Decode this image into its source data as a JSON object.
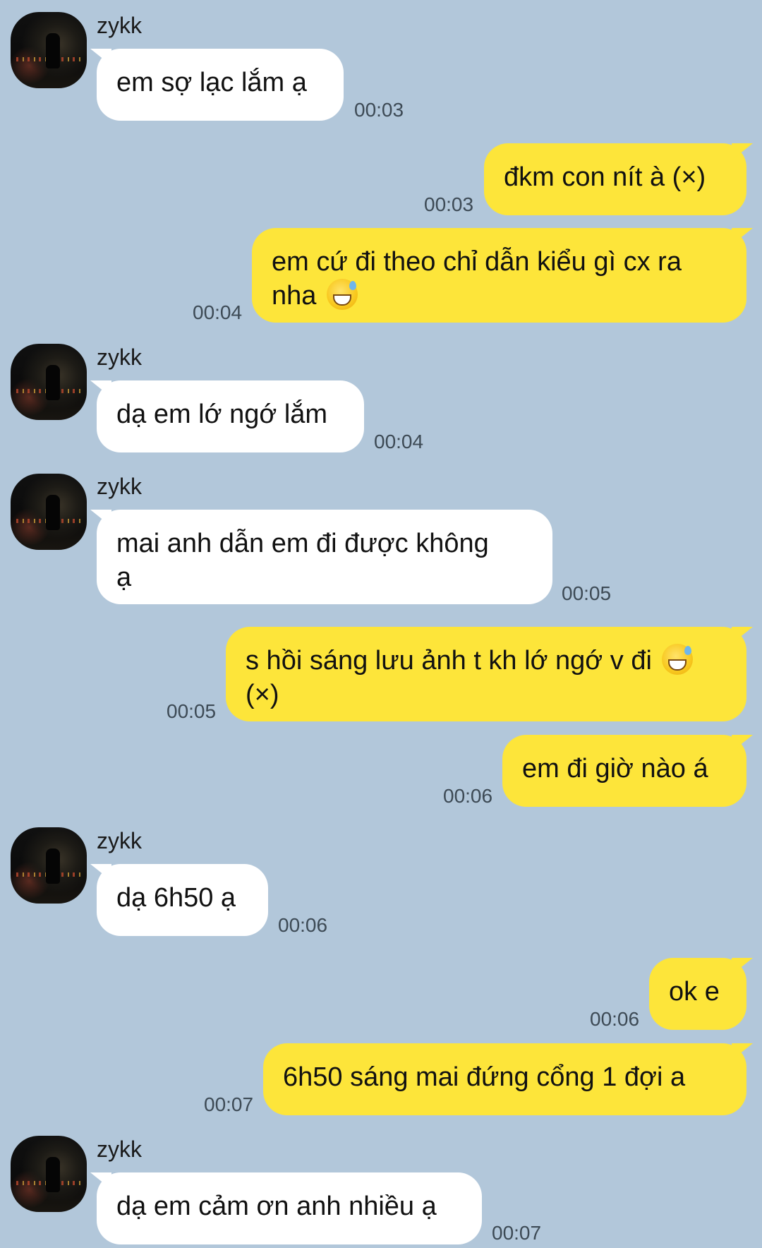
{
  "contact": {
    "name": "zykk"
  },
  "messages": [
    {
      "id": "m1",
      "direction": "in",
      "text": "em sợ lạc lắm ạ",
      "time": "00:03",
      "show_sender": true
    },
    {
      "id": "m2",
      "direction": "out",
      "text": "đkm con nít à (×)",
      "time": "00:03"
    },
    {
      "id": "m3",
      "direction": "out",
      "text_line1": "em cứ đi theo chỉ dẫn kiểu gì cx ra",
      "text_line2": "nha",
      "emoji": "grinning-sweat-emoji",
      "time": "00:04"
    },
    {
      "id": "m4",
      "direction": "in",
      "text": "dạ em lớ ngớ lắm",
      "time": "00:04",
      "show_sender": true
    },
    {
      "id": "m5",
      "direction": "in",
      "text_line1": "mai anh dẫn em đi được không",
      "text_line2": "ạ",
      "time": "00:05",
      "show_sender": true
    },
    {
      "id": "m6",
      "direction": "out",
      "text_line1": "s hồi sáng lưu ảnh t kh lớ ngớ v đi",
      "text_line2": "(×)",
      "emoji": "grinning-sweat-emoji",
      "time": "00:05"
    },
    {
      "id": "m7",
      "direction": "out",
      "text": "em đi giờ nào á",
      "time": "00:06"
    },
    {
      "id": "m8",
      "direction": "in",
      "text": "dạ 6h50 ạ",
      "time": "00:06",
      "show_sender": true
    },
    {
      "id": "m9",
      "direction": "out",
      "text": "ok e",
      "time": "00:06"
    },
    {
      "id": "m10",
      "direction": "out",
      "text": "6h50 sáng mai đứng cổng 1 đợi a",
      "time": "00:07"
    },
    {
      "id": "m11",
      "direction": "in",
      "text": "dạ em cảm ơn anh nhiều ạ",
      "time": "00:07",
      "show_sender": true
    }
  ],
  "colors": {
    "background": "#b2c7da",
    "incoming_bubble": "#ffffff",
    "outgoing_bubble": "#fde53a",
    "timestamp": "#3d4a55"
  }
}
